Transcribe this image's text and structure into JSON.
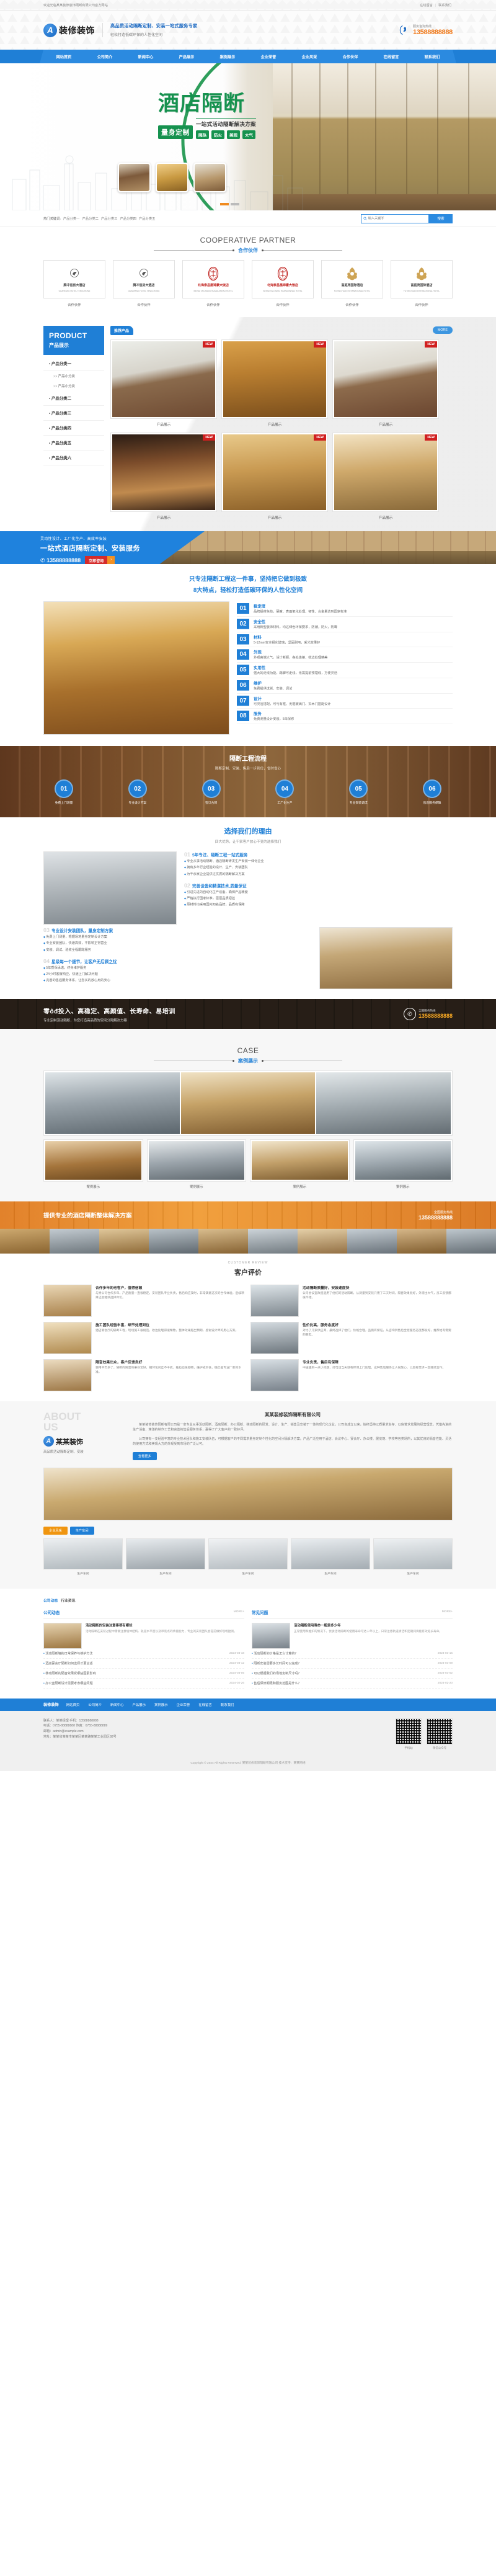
{
  "topbar": {
    "welcome": "欢迎光临某某装修装饰隔断有限公司官方网站",
    "links": [
      "在线留言",
      "联系我们"
    ]
  },
  "header": {
    "logo_letter": "A",
    "logo_text": "装修装饰",
    "slogan_main": "高品质活动隔断定制、安装一站式服务专家",
    "slogan_sub": "轻松打造低碳环保的人性化空间",
    "hotline_label": "服务咨询热线",
    "hotline_number": "13588888888"
  },
  "nav": {
    "items": [
      "网站首页",
      "公司简介",
      "新闻中心",
      "产品展示",
      "案例展示",
      "企业荣誉",
      "企业风采",
      "合作伙伴",
      "在线留言",
      "联系我们"
    ]
  },
  "hero": {
    "title": "酒店隔断",
    "badge": "量身定制",
    "subtitle": "一站式活动隔断解决方案",
    "tags": [
      "隔热",
      "防火",
      "美观",
      "大气"
    ]
  },
  "search": {
    "keywords_label": "热门关键词:",
    "keywords": [
      "产品分类一",
      "产品分类二",
      "产品分类三",
      "产品分类四",
      "产品分类五"
    ],
    "placeholder": "输入关键字",
    "button": "搜索",
    "value": ""
  },
  "partners": {
    "en_title": "COOPERATIVE PARTNER",
    "cn_title": "合作伙伴",
    "items": [
      {
        "name": "腾冲官房大酒店",
        "sub": "GUANFANG HOTEL TENGCHONG",
        "color": "dark"
      },
      {
        "name": "腾冲官房大酒店",
        "sub": "GUANFANG HOTEL TENGCHONG",
        "color": "dark"
      },
      {
        "name": "北海泰昌凰锦豪大饭店",
        "sub": "BEIHAI TAICHANG HUANGJINHAO HOTEL",
        "color": "red"
      },
      {
        "name": "北海泰昌凰锦豪大饭店",
        "sub": "BEIHAI TAICHANG HUANGJINHAO HOTEL",
        "color": "red"
      },
      {
        "name": "富庭苑国际酒店",
        "sub": "FUTINGYUAN INTERNATIONAL HOTEL",
        "color": "dark"
      },
      {
        "name": "富庭苑国际酒店",
        "sub": "FUTINGYUAN INTERNATIONAL HOTEL",
        "color": "dark"
      }
    ],
    "caption": "合作伙伴"
  },
  "product": {
    "side_en": "PRODUCT",
    "side_cn": "产品展示",
    "categories": [
      {
        "label": "产品分类一",
        "subs": [
          "产品小分类",
          "产品小分类"
        ]
      },
      {
        "label": "产品分类二",
        "subs": []
      },
      {
        "label": "产品分类三",
        "subs": []
      },
      {
        "label": "产品分类四",
        "subs": []
      },
      {
        "label": "产品分类五",
        "subs": []
      },
      {
        "label": "产品分类六",
        "subs": []
      }
    ],
    "tab_label": "推荐产品",
    "more_label": "MORE",
    "badge": "NEW",
    "items": [
      {
        "name": "产品展示"
      },
      {
        "name": "产品展示"
      },
      {
        "name": "产品展示"
      },
      {
        "name": "产品展示"
      },
      {
        "name": "产品展示"
      },
      {
        "name": "产品展示"
      }
    ]
  },
  "cta1": {
    "sub": "灵动性设计、工厂化生产、高效率安装",
    "title": "一站式酒店隔断定制、安装服务",
    "phone": "13588888888",
    "button": "立即咨询",
    "arrow": "›"
  },
  "features": {
    "head1": "只专注隔断工程这一件事，坚持把它做到极致",
    "head2": "8大特点，轻松打造低碳环保的人性化空间",
    "items": [
      {
        "no": "01",
        "title": "稳定度",
        "desc": "品牌铝材免检，硬度、表面氧化处理、韧性、合金量达到国家标准"
      },
      {
        "no": "02",
        "title": "安全性",
        "desc": "采用新型装饰材料，均达绿色环保要求，防潮，防火，防霉"
      },
      {
        "no": "03",
        "title": "材料",
        "desc": "5-12mm安全钢化玻璃，坚固耐用，采光效果好"
      },
      {
        "no": "04",
        "title": "外观",
        "desc": "外观高端大气，设计新颖，各处连接、收边处理精美"
      },
      {
        "no": "05",
        "title": "实用性",
        "desc": "强大的走线功能，踢脚可走线，无需提前预埋线，方便灵活"
      },
      {
        "no": "06",
        "title": "维护",
        "desc": "免费提供送货、安装、调试"
      },
      {
        "no": "07",
        "title": "设计",
        "desc": "可灵活搭配，可与有框、无框玻璃门、实木门搭配设计"
      },
      {
        "no": "08",
        "title": "服务",
        "desc": "免费测量设计安装，5年保修"
      }
    ]
  },
  "process": {
    "title": "隔断工程流程",
    "sub": "隔断定制、安装、售后一步到位，省时省心",
    "steps": [
      {
        "no": "01",
        "label": "免费上门测量"
      },
      {
        "no": "02",
        "label": "专业设计方案"
      },
      {
        "no": "03",
        "label": "签订合同"
      },
      {
        "no": "04",
        "label": "工厂化生产"
      },
      {
        "no": "05",
        "label": "专业安装调试"
      },
      {
        "no": "06",
        "label": "售后服务保障"
      }
    ]
  },
  "reasons": {
    "title": "选择我们的理由",
    "sub": "四大优势，让千家客户放心不变的选择我们",
    "blocks": [
      {
        "q": "01",
        "title": "5年专注、隔断工程一站式服务",
        "items": [
          "专业从事活动隔断、酒店隔断研发生产安装一体化企业",
          "拥有多年行业经验的设计、生产、安装团队",
          "为千余家企业提供过优质的隔断解决方案"
        ]
      },
      {
        "q": "02",
        "title": "完善设备和精湛技术,质量保证",
        "items": [
          "引进先进的自动化生产设备，确保产品精度",
          "严格执行国家标准，层层品质把控",
          "原材料均采用国内知名品牌，品质有保障"
        ]
      },
      {
        "q": "03",
        "title": "专业设计安装团队，量身定制方案",
        "items": [
          "免费上门测量，根据场地量身定制设计方案",
          "专业安装团队，快速高效，不影响正常营业",
          "安装、调试、验收全程跟踪服务"
        ]
      },
      {
        "q": "04",
        "title": "星级每一个细节，让客户无后顾之忧",
        "items": [
          "5年质保承诺，终身维护服务",
          "24小时客服响应，快速上门解决问题",
          "完善的售后服务体系，让您买的放心用的安心"
        ]
      }
    ]
  },
  "cta2": {
    "title": "零ôđ投入、高稳定、高颜值、长寿命、易培训",
    "sub": "专业定制活动隔断，为您打造高品质的空间分隔解决方案",
    "phone_label": "全国服务热线",
    "phone": "13588888888"
  },
  "case": {
    "en_title": "CASE",
    "cn_title": "案例展示",
    "items": [
      {
        "name": "案例展示"
      },
      {
        "name": "案例展示"
      },
      {
        "name": "案例展示"
      },
      {
        "name": "案例展示"
      }
    ]
  },
  "cta3": {
    "title": "提供专业的酒店隔断整体解决方案",
    "phone_label": "全国服务热线",
    "phone": "13588888888"
  },
  "testimonials": {
    "en_title": "CUSTOMER REVIEW",
    "cn_title": "客户评价",
    "items": [
      {
        "title": "合作多年的老客户，值得信赖",
        "text": "与贵公司合作多年，产品质量一直很稳定，安装团队专业负责，售后响应及时，非常满意这次的合作体验，后续项目还会继续选择你们。"
      },
      {
        "title": "活动隔断质量好，安装速度快",
        "text": "公司会议室改造选用了他们的活动隔断，从测量到安装只用了三天时间，隔音效果很好，外观也大气，员工反馈都很不错。"
      },
      {
        "title": "施工团队经验丰富，细节处理到位",
        "text": "酒店宴会厅的隔断工程，现场施工很规范，收边处理得很精致，整体效果超出预期，感谢设计师的用心方案。"
      },
      {
        "title": "性价比高，服务态度好",
        "text": "对比了几家供应商，最终选择了他们，价格合理，品质有保证，从咨询到售后全程服务态度都很好，推荐给有需要的朋友。"
      },
      {
        "title": "隔音效果出众，客户反馈良好",
        "text": "使用半年多了，隔断的隔音效果非常好，相邻包间互不干扰，推拉也很顺畅，维护成本低，确实是专业厂家的水准。"
      },
      {
        "title": "专业负责，售后有保障",
        "text": "中途遇到一点小问题，打电话当天就有师傅上门处理，这种售后服务让人很放心，以后有需求一定继续合作。"
      }
    ]
  },
  "about": {
    "watermark_line1": "ABOUT",
    "watermark_line2": "US",
    "logo_letter": "A",
    "brand": "某某装饰",
    "tagline": "高品质活动隔断定制、安装",
    "title": "某某装修装饰隔断有限公司",
    "paragraphs": [
      "某某装修装饰隔断有限公司是一家专业从事活动隔断、酒店隔断、办公隔断、移动隔断的研发、设计、生产、销售及安装于一体的现代化企业。公司自成立以来，始终坚持以质量求生存、以信誉求发展的经营理念，凭借先进的生产设备、精湛的制作工艺和完善的售后服务体系，赢得了广大客户的一致好评。",
      "公司拥有一支经验丰富的专业技术团队和施工安装队伍，可根据客户的不同需求量身定制个性化的空间分隔解决方案。产品广泛应用于酒店、会议中心、宴会厅、办公楼、展览馆、学校等各类场所，以其优良的隔音性能、灵活的使用方式和美观大方的外观受到市场的广泛认可。"
    ],
    "more": "查看更多",
    "tabs": [
      "企业风采",
      "生产车间"
    ],
    "thumbs": [
      {
        "cap": "生产车间"
      },
      {
        "cap": "生产车间"
      },
      {
        "cap": "生产车间"
      },
      {
        "cap": "生产车间"
      },
      {
        "cap": "生产车间"
      }
    ]
  },
  "news": {
    "tabs": [
      "公司动态",
      "行业资讯"
    ],
    "columns": [
      {
        "title": "公司动态",
        "more": "MORE+",
        "feature": {
          "title": "活动隔断的安装注意事项有哪些",
          "desc": "活动隔断在安装过程中需要注意墙体结构、轨道水平度以及吊装点的承重能力，专业的安装团队会提前做好现场勘测。"
        },
        "list": [
          {
            "t": "活动隔断墙的日常保养与维护方法",
            "d": "2024-03-18"
          },
          {
            "t": "酒店宴会厅隔断如何选择才更合适",
            "d": "2024-03-12"
          },
          {
            "t": "移动隔断的隔音效果受哪些因素影响",
            "d": "2024-03-05"
          },
          {
            "t": "办公室隔断设计需要考虑哪些问题",
            "d": "2024-02-26"
          }
        ]
      },
      {
        "title": "常见问题",
        "more": "MORE+",
        "feature": {
          "title": "活动隔断使用寿命一般是多少年",
          "desc": "正常使用和维护的情况下，优质活动隔断的使用寿命可达十年以上，日常注意轨道清洁和定期润滑能有效延长寿命。"
        },
        "list": [
          {
            "t": "活动隔断的价格是怎么计算的？",
            "d": "2024-03-16"
          },
          {
            "t": "隔断安装需要多长时间可以完成？",
            "d": "2024-03-09"
          },
          {
            "t": "可以根据我们的场地定制尺寸吗？",
            "d": "2024-03-02"
          },
          {
            "t": "售后保修期限和服务范围是什么？",
            "d": "2024-02-20"
          }
        ]
      }
    ]
  },
  "footer": {
    "brand": "装修装饰",
    "nav_items": [
      "网站首页",
      "公司简介",
      "新闻中心",
      "产品展示",
      "案例展示",
      "企业荣誉",
      "在线留言",
      "联系我们"
    ],
    "lines": [
      "联系人：某某经理    手机：13588888888",
      "电话：0755-88888888    传真：0755-88888889",
      "邮箱：admin@example.com",
      "地址：某某省某某市某某区某某路某某工业园区88号"
    ],
    "qrs": [
      {
        "cap": "手机站"
      },
      {
        "cap": "微信公众号"
      }
    ],
    "copyright": "Copyright © 2024 All Rights Reserved.  某某装修装饰隔断有限公司  技术支持：某某网络"
  }
}
